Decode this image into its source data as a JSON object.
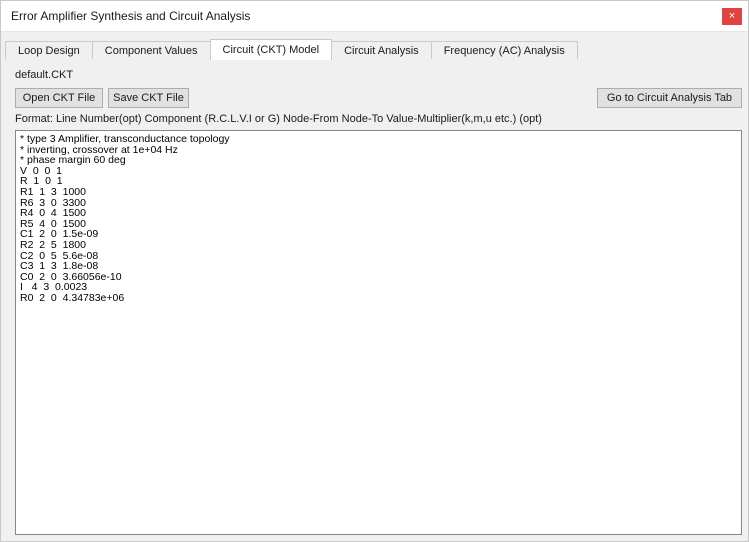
{
  "window": {
    "title": "Error Amplifier Synthesis and Circuit Analysis",
    "close_glyph": "×"
  },
  "tabs": [
    {
      "label": "Loop Design",
      "active": false
    },
    {
      "label": "Component Values",
      "active": false
    },
    {
      "label": "Circuit (CKT) Model",
      "active": true
    },
    {
      "label": "Circuit Analysis",
      "active": false
    },
    {
      "label": "Frequency (AC) Analysis",
      "active": false
    }
  ],
  "panel": {
    "filename": "default.CKT",
    "open_button": "Open CKT File",
    "save_button": "Save CKT File",
    "goto_button": "Go to Circuit Analysis Tab",
    "format_line": "Format:  Line Number(opt)   Component (R.C.L.V.I or G)   Node-From   Node-To   Value-Multiplier(k,m,u etc.) (opt)"
  },
  "editor": {
    "lines": [
      "* type 3 Amplifier, transconductance topology",
      "* inverting, crossover at 1e+04 Hz",
      "* phase margin 60 deg",
      "V  0  0  1",
      "R  1  0  1",
      "R1  1  3  1000",
      "R6  3  0  3300",
      "R4  0  4  1500",
      "R5  4  0  1500",
      "C1  2  0  1.5e-09",
      "R2  2  5  1800",
      "C2  0  5  5.6e-08",
      "C3  1  3  1.8e-08",
      "C0  2  0  3.66056e-10",
      "I   4  3  0.0023",
      "R0  2  0  4.34783e+06"
    ]
  },
  "colors": {
    "close_button": "#e04343",
    "window_bg": "#f0f0f0",
    "editor_bg": "#ffffff"
  }
}
